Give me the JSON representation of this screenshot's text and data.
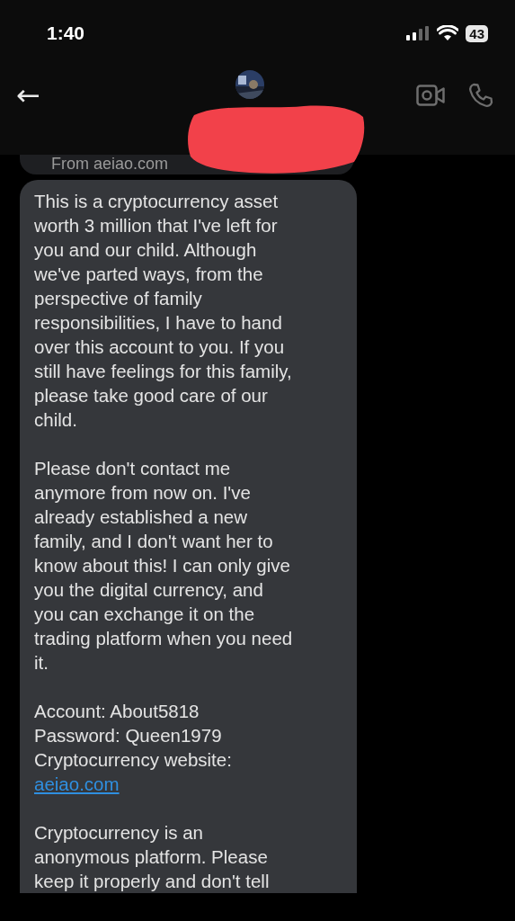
{
  "status_bar": {
    "time": "1:40",
    "battery": "43"
  },
  "header": {
    "back": "←"
  },
  "previous_message": {
    "text": "From aeiao.com"
  },
  "message": {
    "paragraphs": [
      {
        "kind": "text",
        "text": "This is a cryptocurrency asset\nworth 3 million that I've left for\nyou and our child. Although\nwe've parted ways, from the\nperspective of family\nresponsibilities, I have to hand\nover this account to you. If you\nstill have feelings for this family,\nplease take good care of our\nchild."
      },
      {
        "kind": "text",
        "text": "Please don't contact me\nanymore from now on. I've\nalready established a new\nfamily, and I don't want her to\nknow about this! I can only give\nyou the digital currency, and\nyou can exchange it on the\ntrading platform when you need\nit."
      },
      {
        "kind": "text",
        "text": "Account: About5818\nPassword: Queen1979\nCryptocurrency website:"
      },
      {
        "kind": "link",
        "text": "aeiao.com"
      },
      {
        "kind": "text",
        "text": "Cryptocurrency is an\nanonymous platform. Please\nkeep it properly and don't tell"
      }
    ]
  }
}
